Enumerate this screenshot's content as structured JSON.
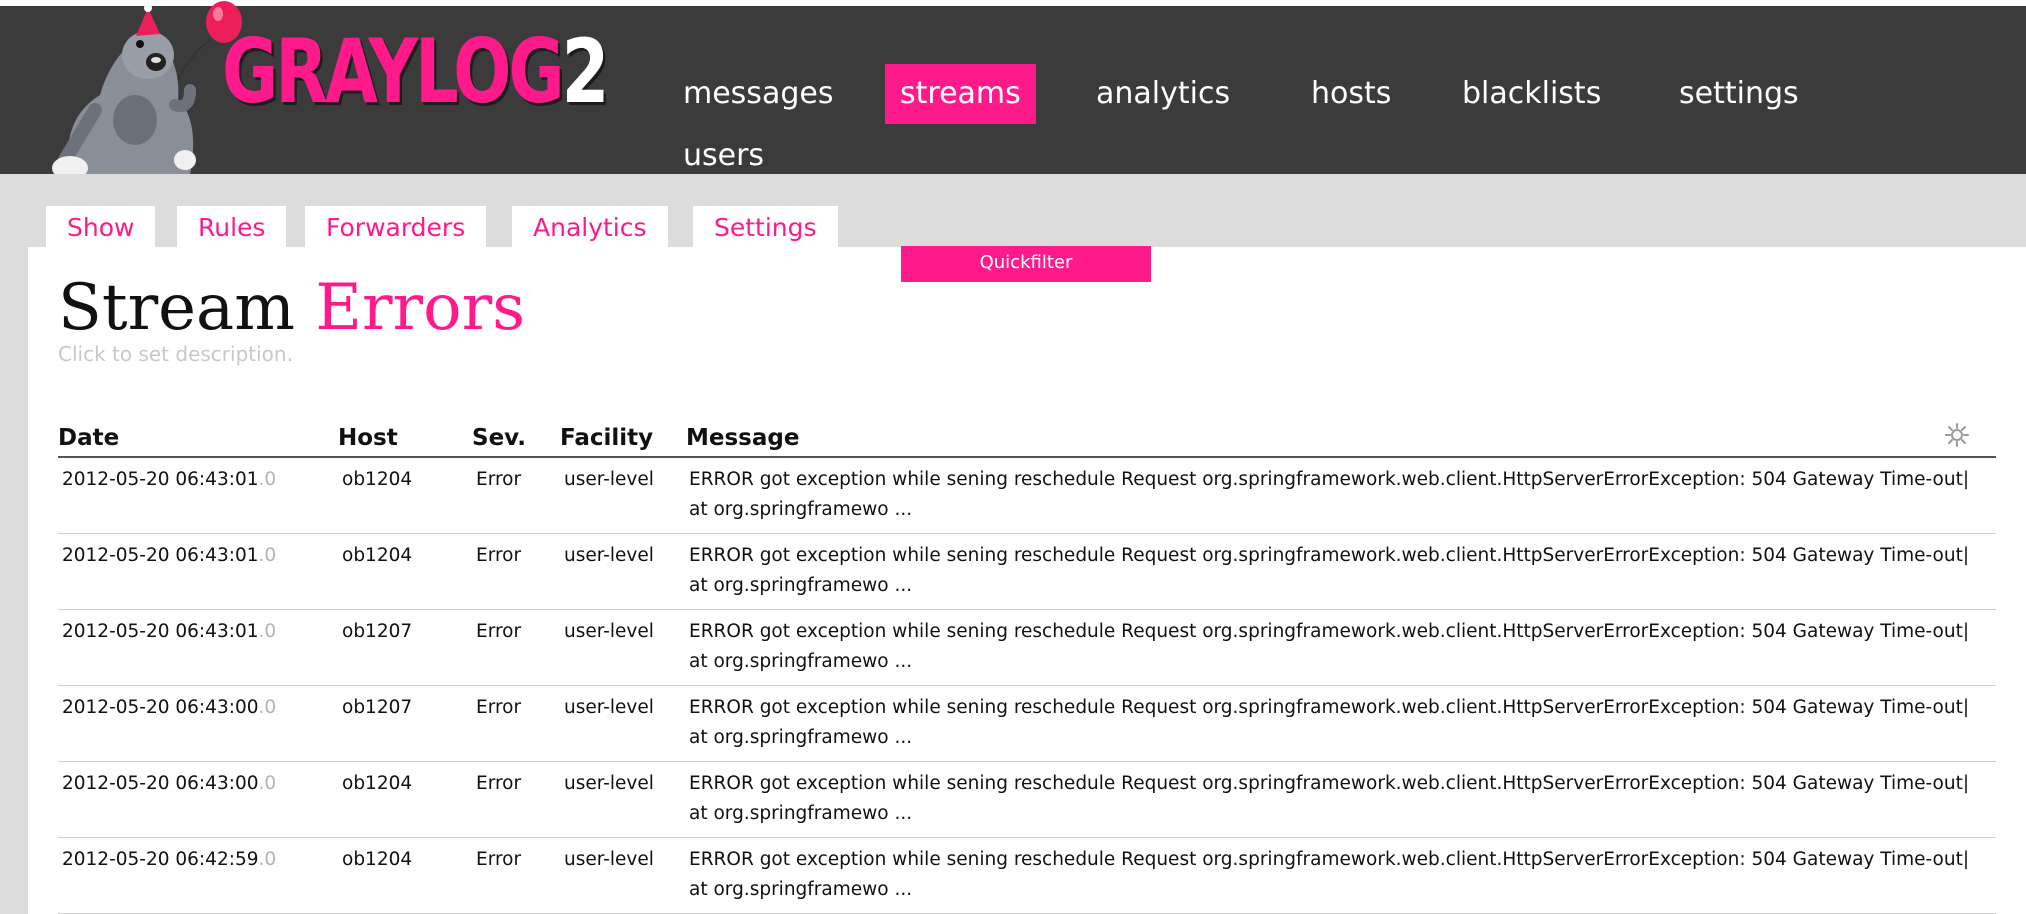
{
  "header": {
    "logo_main": "GRAYLOG",
    "logo_num": "2",
    "nav": [
      {
        "label": "messages",
        "active": false
      },
      {
        "label": "streams",
        "active": true
      },
      {
        "label": "analytics",
        "active": false
      },
      {
        "label": "hosts",
        "active": false
      },
      {
        "label": "blacklists",
        "active": false
      },
      {
        "label": "settings",
        "active": false
      },
      {
        "label": "users",
        "active": false
      }
    ]
  },
  "tabs": [
    "Show",
    "Rules",
    "Forwarders",
    "Analytics",
    "Settings"
  ],
  "quickfilter_label": "Quickfilter",
  "page": {
    "title_prefix": "Stream",
    "title_name": "Errors",
    "description_placeholder": "Click to set description."
  },
  "table": {
    "columns": [
      "Date",
      "Host",
      "Sev.",
      "Facility",
      "Message"
    ],
    "settings_icon": "gear-icon",
    "rows": [
      {
        "date": "2012-05-20 06:43:01",
        "ms": ".0",
        "host": "ob1204",
        "sev": "Error",
        "facility": "user-level",
        "message": "ERROR got exception while sening reschedule Request org.springframework.web.client.HttpServerErrorException: 504 Gateway Time-out| at org.springframewo ..."
      },
      {
        "date": "2012-05-20 06:43:01",
        "ms": ".0",
        "host": "ob1204",
        "sev": "Error",
        "facility": "user-level",
        "message": "ERROR got exception while sening reschedule Request org.springframework.web.client.HttpServerErrorException: 504 Gateway Time-out| at org.springframewo ..."
      },
      {
        "date": "2012-05-20 06:43:01",
        "ms": ".0",
        "host": "ob1207",
        "sev": "Error",
        "facility": "user-level",
        "message": "ERROR got exception while sening reschedule Request org.springframework.web.client.HttpServerErrorException: 504 Gateway Time-out| at org.springframewo ..."
      },
      {
        "date": "2012-05-20 06:43:00",
        "ms": ".0",
        "host": "ob1207",
        "sev": "Error",
        "facility": "user-level",
        "message": "ERROR got exception while sening reschedule Request org.springframework.web.client.HttpServerErrorException: 504 Gateway Time-out| at org.springframewo ..."
      },
      {
        "date": "2012-05-20 06:43:00",
        "ms": ".0",
        "host": "ob1204",
        "sev": "Error",
        "facility": "user-level",
        "message": "ERROR got exception while sening reschedule Request org.springframework.web.client.HttpServerErrorException: 504 Gateway Time-out| at org.springframewo ..."
      },
      {
        "date": "2012-05-20 06:42:59",
        "ms": ".0",
        "host": "ob1204",
        "sev": "Error",
        "facility": "user-level",
        "message": "ERROR got exception while sening reschedule Request org.springframework.web.client.HttpServerErrorException: 504 Gateway Time-out| at org.springframewo ..."
      }
    ]
  },
  "colors": {
    "accent": "#ff1a8c",
    "header_bg": "#3b3b3b",
    "tab_band": "#dcdcdc"
  }
}
